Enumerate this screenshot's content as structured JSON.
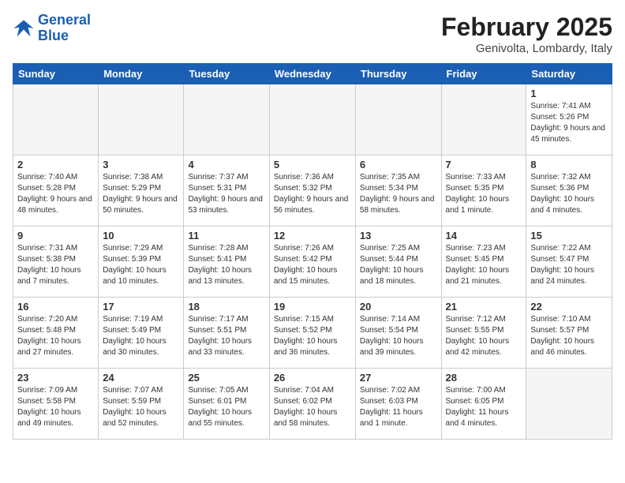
{
  "header": {
    "logo_line1": "General",
    "logo_line2": "Blue",
    "month": "February 2025",
    "location": "Genivolta, Lombardy, Italy"
  },
  "weekdays": [
    "Sunday",
    "Monday",
    "Tuesday",
    "Wednesday",
    "Thursday",
    "Friday",
    "Saturday"
  ],
  "weeks": [
    [
      {
        "day": "",
        "info": ""
      },
      {
        "day": "",
        "info": ""
      },
      {
        "day": "",
        "info": ""
      },
      {
        "day": "",
        "info": ""
      },
      {
        "day": "",
        "info": ""
      },
      {
        "day": "",
        "info": ""
      },
      {
        "day": "1",
        "info": "Sunrise: 7:41 AM\nSunset: 5:26 PM\nDaylight: 9 hours and 45 minutes."
      }
    ],
    [
      {
        "day": "2",
        "info": "Sunrise: 7:40 AM\nSunset: 5:28 PM\nDaylight: 9 hours and 48 minutes."
      },
      {
        "day": "3",
        "info": "Sunrise: 7:38 AM\nSunset: 5:29 PM\nDaylight: 9 hours and 50 minutes."
      },
      {
        "day": "4",
        "info": "Sunrise: 7:37 AM\nSunset: 5:31 PM\nDaylight: 9 hours and 53 minutes."
      },
      {
        "day": "5",
        "info": "Sunrise: 7:36 AM\nSunset: 5:32 PM\nDaylight: 9 hours and 56 minutes."
      },
      {
        "day": "6",
        "info": "Sunrise: 7:35 AM\nSunset: 5:34 PM\nDaylight: 9 hours and 58 minutes."
      },
      {
        "day": "7",
        "info": "Sunrise: 7:33 AM\nSunset: 5:35 PM\nDaylight: 10 hours and 1 minute."
      },
      {
        "day": "8",
        "info": "Sunrise: 7:32 AM\nSunset: 5:36 PM\nDaylight: 10 hours and 4 minutes."
      }
    ],
    [
      {
        "day": "9",
        "info": "Sunrise: 7:31 AM\nSunset: 5:38 PM\nDaylight: 10 hours and 7 minutes."
      },
      {
        "day": "10",
        "info": "Sunrise: 7:29 AM\nSunset: 5:39 PM\nDaylight: 10 hours and 10 minutes."
      },
      {
        "day": "11",
        "info": "Sunrise: 7:28 AM\nSunset: 5:41 PM\nDaylight: 10 hours and 13 minutes."
      },
      {
        "day": "12",
        "info": "Sunrise: 7:26 AM\nSunset: 5:42 PM\nDaylight: 10 hours and 15 minutes."
      },
      {
        "day": "13",
        "info": "Sunrise: 7:25 AM\nSunset: 5:44 PM\nDaylight: 10 hours and 18 minutes."
      },
      {
        "day": "14",
        "info": "Sunrise: 7:23 AM\nSunset: 5:45 PM\nDaylight: 10 hours and 21 minutes."
      },
      {
        "day": "15",
        "info": "Sunrise: 7:22 AM\nSunset: 5:47 PM\nDaylight: 10 hours and 24 minutes."
      }
    ],
    [
      {
        "day": "16",
        "info": "Sunrise: 7:20 AM\nSunset: 5:48 PM\nDaylight: 10 hours and 27 minutes."
      },
      {
        "day": "17",
        "info": "Sunrise: 7:19 AM\nSunset: 5:49 PM\nDaylight: 10 hours and 30 minutes."
      },
      {
        "day": "18",
        "info": "Sunrise: 7:17 AM\nSunset: 5:51 PM\nDaylight: 10 hours and 33 minutes."
      },
      {
        "day": "19",
        "info": "Sunrise: 7:15 AM\nSunset: 5:52 PM\nDaylight: 10 hours and 36 minutes."
      },
      {
        "day": "20",
        "info": "Sunrise: 7:14 AM\nSunset: 5:54 PM\nDaylight: 10 hours and 39 minutes."
      },
      {
        "day": "21",
        "info": "Sunrise: 7:12 AM\nSunset: 5:55 PM\nDaylight: 10 hours and 42 minutes."
      },
      {
        "day": "22",
        "info": "Sunrise: 7:10 AM\nSunset: 5:57 PM\nDaylight: 10 hours and 46 minutes."
      }
    ],
    [
      {
        "day": "23",
        "info": "Sunrise: 7:09 AM\nSunset: 5:58 PM\nDaylight: 10 hours and 49 minutes."
      },
      {
        "day": "24",
        "info": "Sunrise: 7:07 AM\nSunset: 5:59 PM\nDaylight: 10 hours and 52 minutes."
      },
      {
        "day": "25",
        "info": "Sunrise: 7:05 AM\nSunset: 6:01 PM\nDaylight: 10 hours and 55 minutes."
      },
      {
        "day": "26",
        "info": "Sunrise: 7:04 AM\nSunset: 6:02 PM\nDaylight: 10 hours and 58 minutes."
      },
      {
        "day": "27",
        "info": "Sunrise: 7:02 AM\nSunset: 6:03 PM\nDaylight: 11 hours and 1 minute."
      },
      {
        "day": "28",
        "info": "Sunrise: 7:00 AM\nSunset: 6:05 PM\nDaylight: 11 hours and 4 minutes."
      },
      {
        "day": "",
        "info": ""
      }
    ]
  ]
}
